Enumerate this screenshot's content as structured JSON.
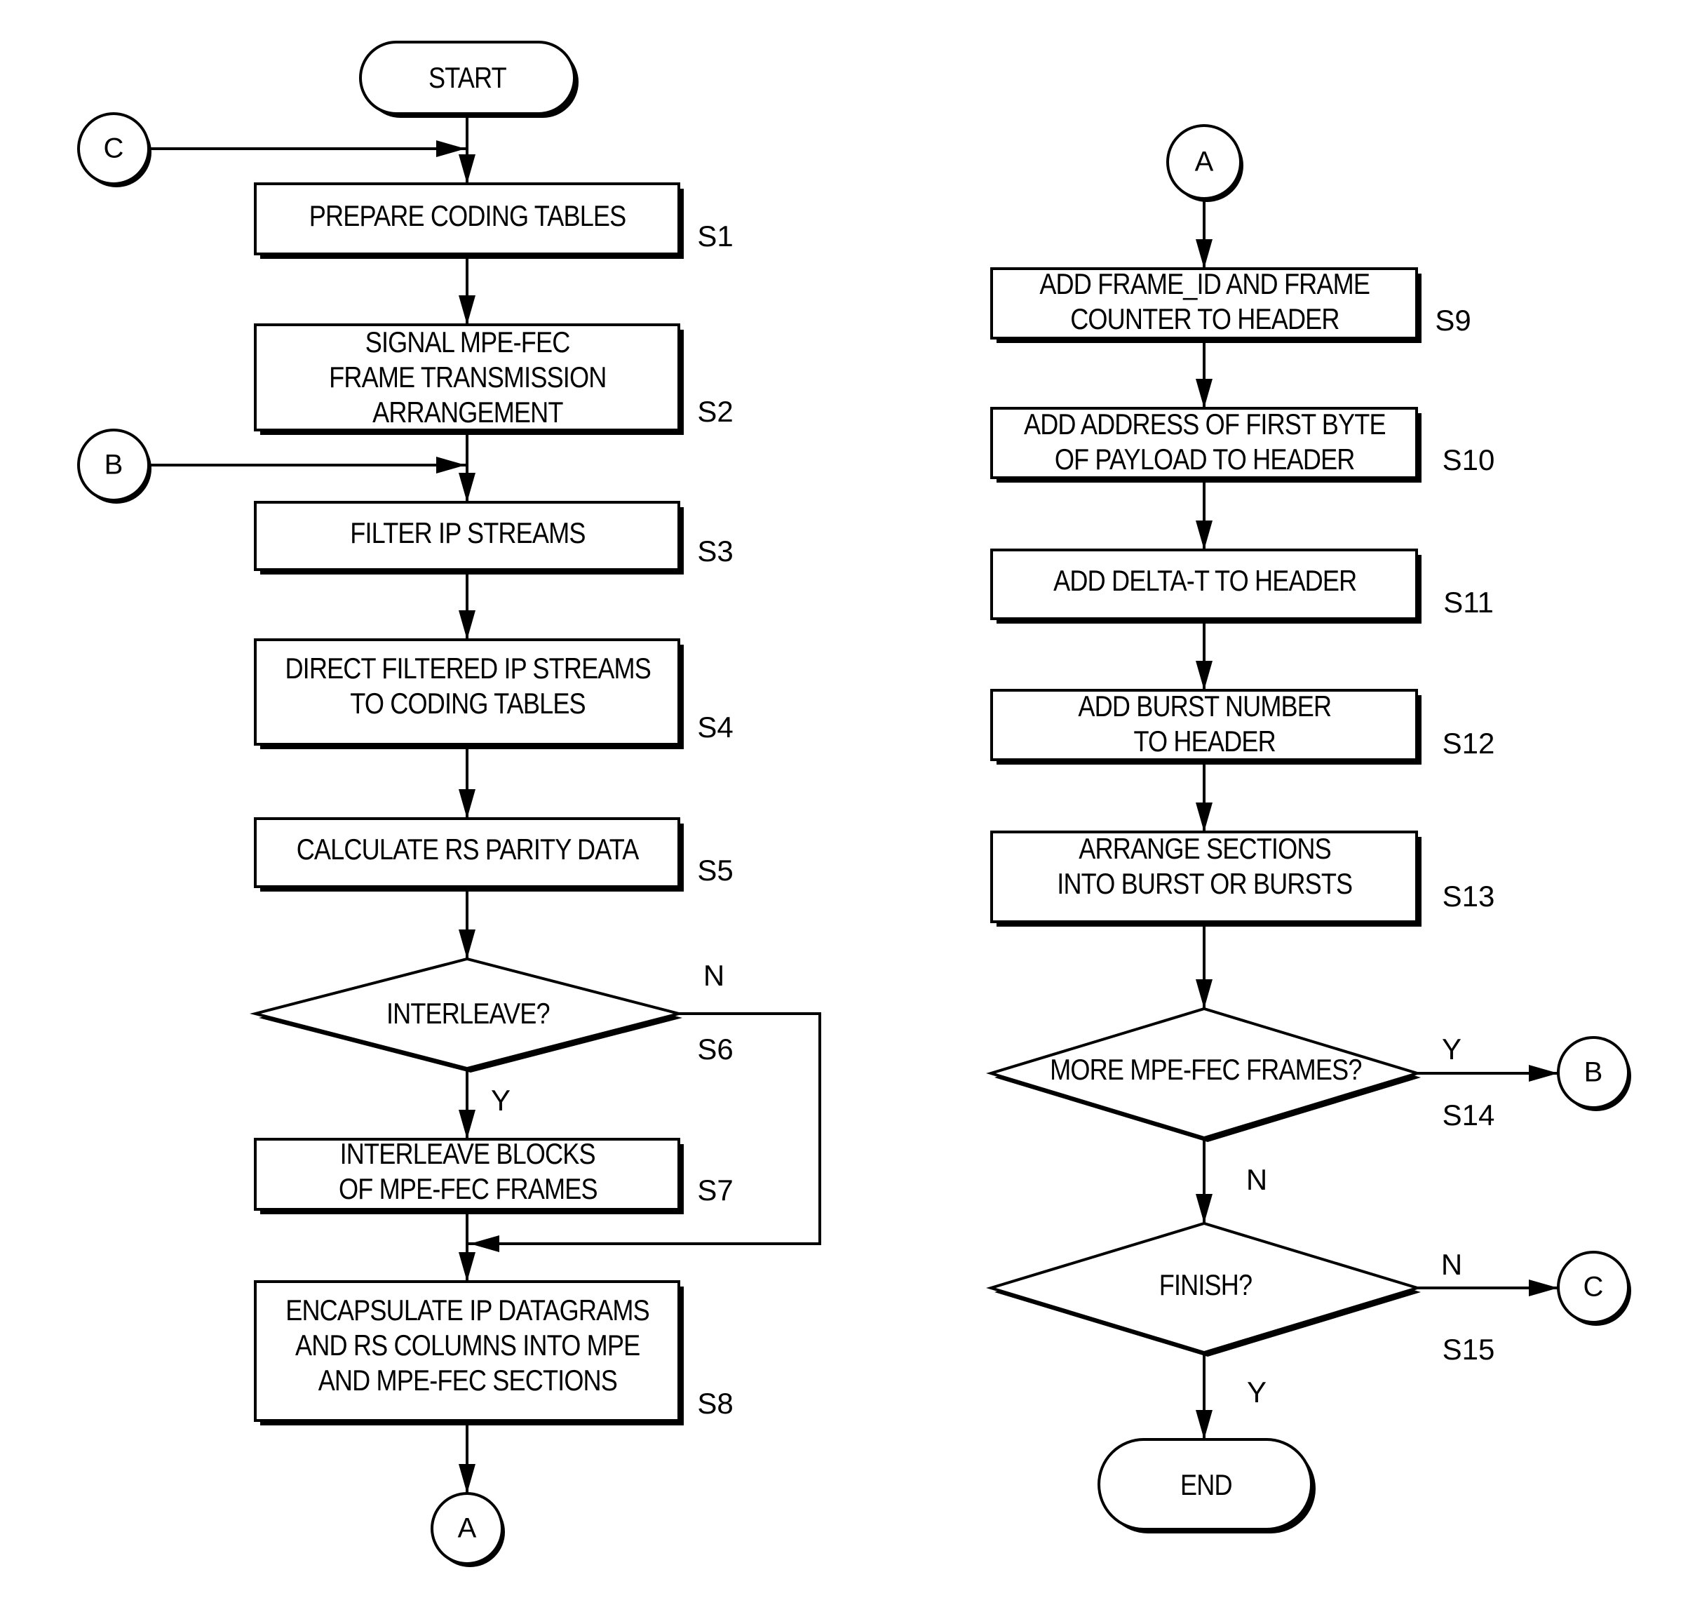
{
  "terminals": {
    "start": "START",
    "end": "END"
  },
  "steps": {
    "s1": {
      "id": "S1",
      "lines": [
        "PREPARE CODING TABLES"
      ]
    },
    "s2": {
      "id": "S2",
      "lines": [
        "SIGNAL MPE-FEC",
        "FRAME TRANSMISSION",
        "ARRANGEMENT"
      ]
    },
    "s3": {
      "id": "S3",
      "lines": [
        "FILTER IP STREAMS"
      ]
    },
    "s4": {
      "id": "S4",
      "lines": [
        "DIRECT FILTERED IP STREAMS",
        "TO CODING TABLES"
      ]
    },
    "s5": {
      "id": "S5",
      "lines": [
        "CALCULATE RS PARITY DATA"
      ]
    },
    "s6": {
      "id": "S6",
      "lines": [
        "INTERLEAVE?"
      ],
      "yes": "Y",
      "no": "N"
    },
    "s7": {
      "id": "S7",
      "lines": [
        "INTERLEAVE BLOCKS",
        "OF MPE-FEC FRAMES"
      ]
    },
    "s8": {
      "id": "S8",
      "lines": [
        "ENCAPSULATE IP DATAGRAMS",
        "AND RS COLUMNS INTO MPE",
        "AND MPE-FEC SECTIONS"
      ]
    },
    "s9": {
      "id": "S9",
      "lines": [
        "ADD FRAME_ID AND FRAME",
        "COUNTER TO HEADER"
      ]
    },
    "s10": {
      "id": "S10",
      "lines": [
        "ADD ADDRESS OF FIRST BYTE",
        "OF PAYLOAD TO HEADER"
      ]
    },
    "s11": {
      "id": "S11",
      "lines": [
        "ADD DELTA-T TO HEADER"
      ]
    },
    "s12": {
      "id": "S12",
      "lines": [
        "ADD BURST NUMBER",
        "TO HEADER"
      ]
    },
    "s13": {
      "id": "S13",
      "lines": [
        "ARRANGE SECTIONS",
        "INTO BURST OR BURSTS"
      ]
    },
    "s14": {
      "id": "S14",
      "lines": [
        "MORE MPE-FEC FRAMES?"
      ],
      "yes": "Y",
      "no": "N"
    },
    "s15": {
      "id": "S15",
      "lines": [
        "FINISH?"
      ],
      "yes": "Y",
      "no": "N"
    }
  },
  "connectors": {
    "a": "A",
    "b": "B",
    "c": "C"
  }
}
